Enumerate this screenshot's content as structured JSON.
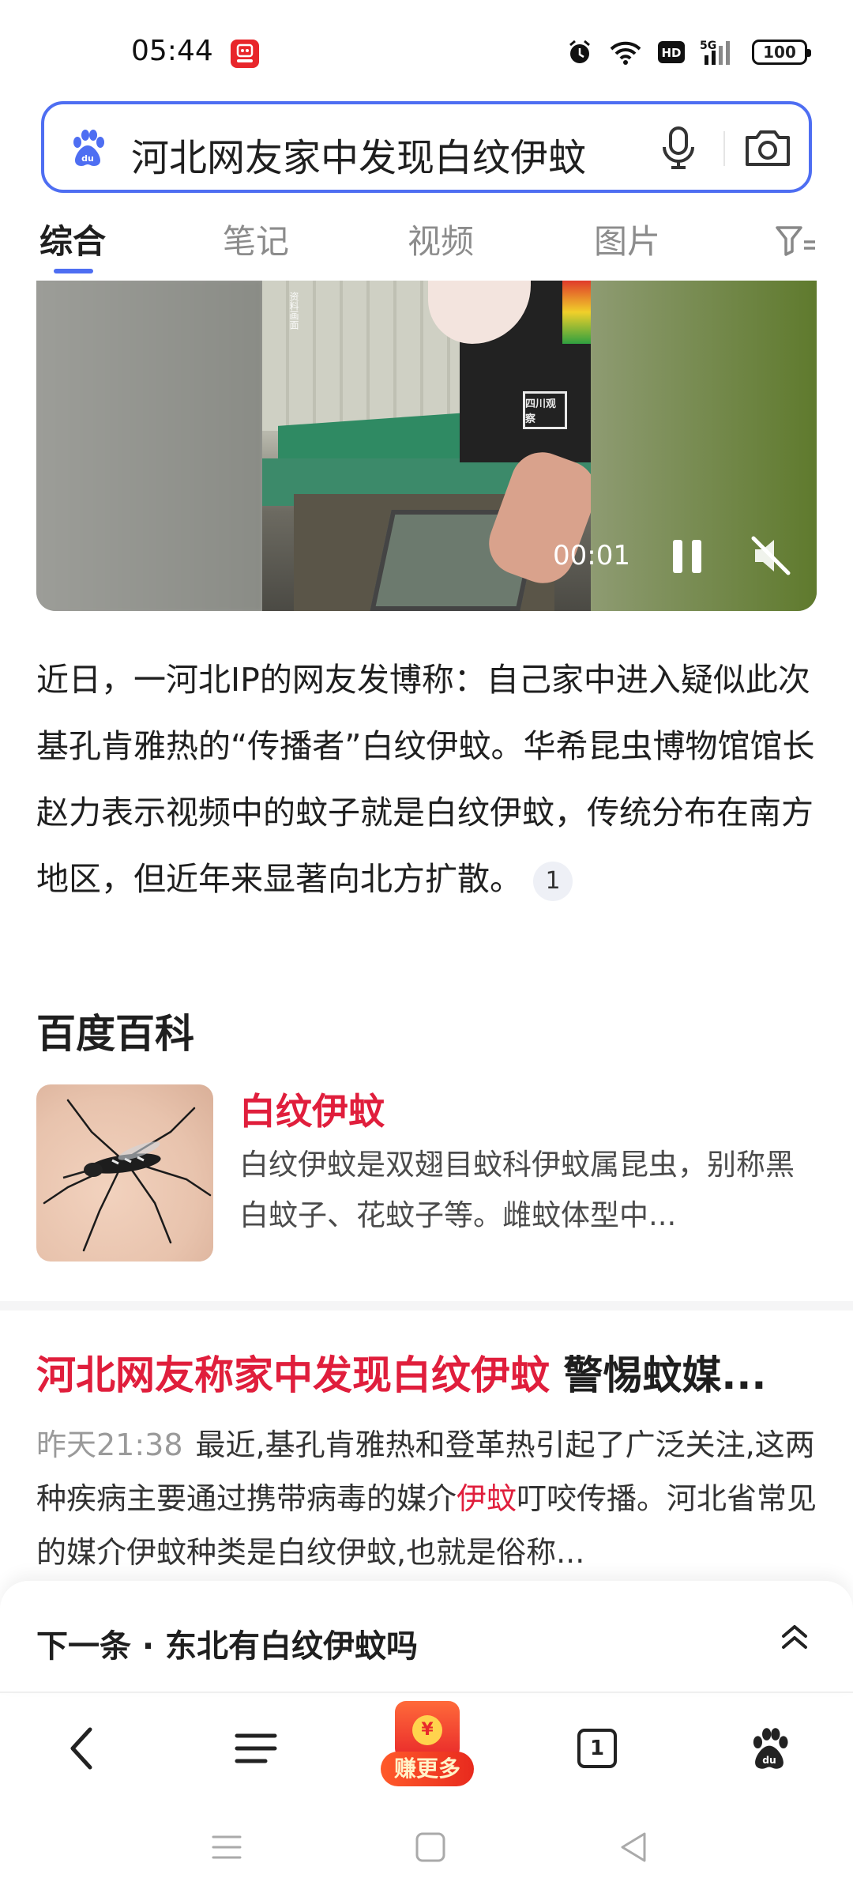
{
  "status_bar": {
    "time": "05:44",
    "app_icon": "baidu-app-notification-icon",
    "icons": [
      "alarm-icon",
      "wifi-icon",
      "hd-icon",
      "5g-signal-icon"
    ],
    "battery": "100"
  },
  "search": {
    "query": "河北网友家中发现白纹伊蚊",
    "icons": [
      "baidu-paw-icon",
      "microphone-icon",
      "camera-icon"
    ]
  },
  "tabs": [
    {
      "label": "综合",
      "active": true
    },
    {
      "label": "笔记",
      "active": false
    },
    {
      "label": "视频",
      "active": false
    },
    {
      "label": "图片",
      "active": false
    }
  ],
  "video": {
    "current_time": "00:01",
    "watermark": "资料画面",
    "logo_text": "四川观察",
    "playing": true,
    "muted": true
  },
  "summary": {
    "text": "近日，一河北IP的网友发博称：自己家中进入疑似此次基孔肯雅热的“传播者”白纹伊蚊。华希昆虫博物馆馆长赵力表示视频中的蚊子就是白纹伊蚊，传统分布在南方地区，但近年来显著向北方扩散。",
    "citation": "1"
  },
  "baike": {
    "section_title": "百度百科",
    "name": "白纹伊蚊",
    "description": "白纹伊蚊是双翅目蚊科伊蚊属昆虫，别称黑白蚊子、花蚊子等。雌蚊体型中..."
  },
  "news": {
    "title_highlight": "河北网友称家中发现白纹伊蚊",
    "title_rest": " 警惕蚊媒...",
    "time": "昨天21:38",
    "body_part1": "最近,基孔肯雅热和登革热引起了广泛关注,这两种疾病主要通过携带病毒的媒介",
    "body_highlight": "伊蚊",
    "body_part2": "叮咬传播。河北省常见的媒介伊蚊种类是白纹伊蚊,也就是俗称..."
  },
  "next_card": {
    "text": "下一条 · 东北有白纹伊蚊吗"
  },
  "toolbar": {
    "redpack_coin": "¥",
    "redpack_label": "赚更多",
    "tab_count": "1"
  },
  "colors": {
    "brand_blue": "#4e6ef2",
    "highlight_red": "#e01e3c"
  }
}
